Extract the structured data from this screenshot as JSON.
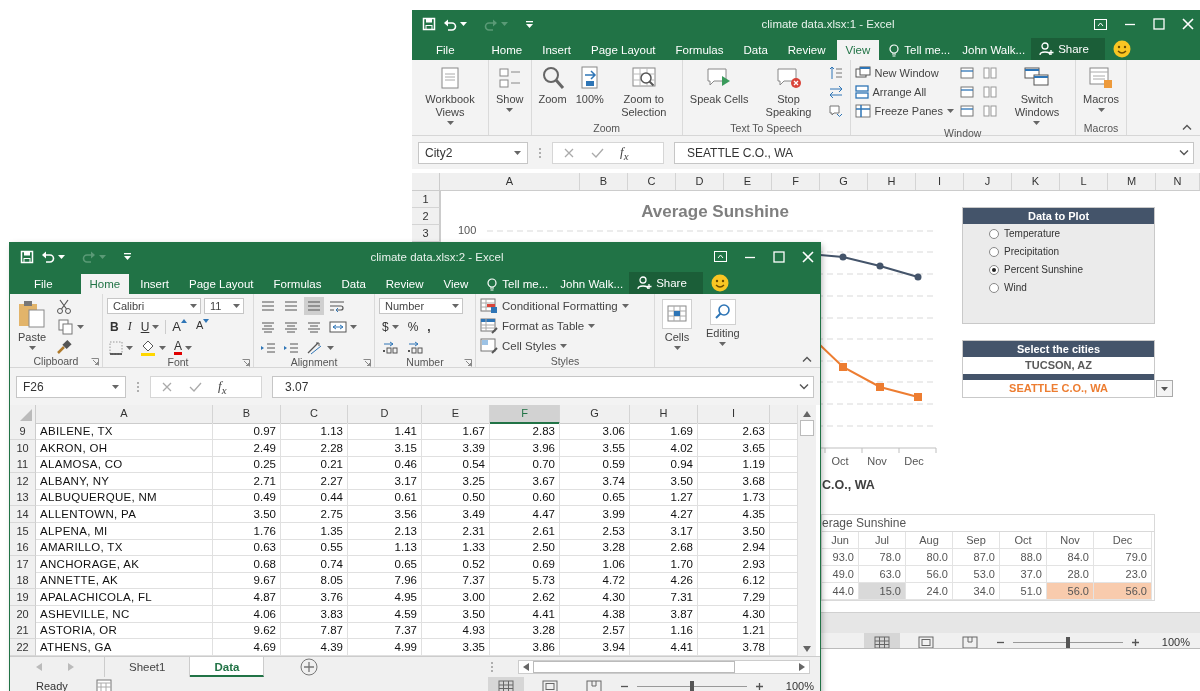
{
  "back_window": {
    "title": "climate data.xlsx:1 - Excel",
    "tabs": [
      {
        "label": "File",
        "selected": false
      },
      {
        "label": "Home",
        "selected": false
      },
      {
        "label": "Insert",
        "selected": false
      },
      {
        "label": "Page Layout",
        "selected": false
      },
      {
        "label": "Formulas",
        "selected": false
      },
      {
        "label": "Data",
        "selected": false
      },
      {
        "label": "Review",
        "selected": false
      },
      {
        "label": "View",
        "selected": true
      }
    ],
    "tell_me": "Tell me...",
    "account": "John Walk...",
    "share": "Share",
    "ribbon_groups": [
      {
        "items": [
          {
            "kind": "large",
            "label": "Workbook Views",
            "menu": true
          }
        ]
      },
      {
        "items": [
          {
            "kind": "large",
            "label": "Show",
            "menu": true
          }
        ]
      },
      {
        "label": "Zoom",
        "items": [
          {
            "kind": "large",
            "label": "Zoom",
            "menu": false
          },
          {
            "kind": "large",
            "label": "100%",
            "menu": false
          },
          {
            "kind": "large",
            "label": "Zoom to Selection",
            "menu": false
          }
        ]
      },
      {
        "label": "Text To Speech",
        "items": [
          {
            "kind": "large",
            "label": "Speak Cells",
            "menu": false
          },
          {
            "kind": "large",
            "label": "Stop Speaking",
            "menu": false
          },
          {
            "kind": "icon"
          },
          {
            "kind": "icon"
          },
          {
            "kind": "icon"
          }
        ]
      },
      {
        "label": "Window",
        "items": [
          {
            "kind": "small",
            "label": "New Window",
            "menu": false
          },
          {
            "kind": "small",
            "label": "Arrange All",
            "menu": false
          },
          {
            "kind": "small",
            "label": "Freeze Panes",
            "menu": true
          },
          {
            "kind": "icon"
          },
          {
            "kind": "icon"
          },
          {
            "kind": "icon"
          },
          {
            "kind": "icon"
          },
          {
            "kind": "icon"
          },
          {
            "kind": "icon"
          },
          {
            "kind": "large",
            "label": "Switch Windows",
            "menu": true
          }
        ]
      },
      {
        "label": "Macros",
        "items": [
          {
            "kind": "large",
            "label": "Macros",
            "menu": true
          }
        ]
      }
    ],
    "name_box": "City2",
    "function_label": "f$_{x}$",
    "formula": "SEATTLE C.O., WA",
    "columns": [
      "A",
      "B",
      "C",
      "D",
      "E",
      "F",
      "G",
      "H",
      "I",
      "J",
      "K",
      "L",
      "M",
      "N"
    ],
    "rows": [
      "1",
      "2",
      "3"
    ],
    "chart": {
      "title": "Average Sunshine",
      "y_tick": "100",
      "x_labels": [
        "Oct",
        "Nov",
        "Dec"
      ],
      "subtitle": "C.O., WA"
    },
    "plot_panel": {
      "title": "Data to Plot",
      "options": [
        {
          "label": "Temperature",
          "selected": false
        },
        {
          "label": "Precipitation",
          "selected": false
        },
        {
          "label": "Percent Sunshine",
          "selected": true
        },
        {
          "label": "Wind",
          "selected": false
        }
      ]
    },
    "cities_panel": {
      "title": "Select the cities",
      "cities": [
        {
          "name": "TUCSON, AZ",
          "color": "#595959"
        },
        {
          "name": "SEATTLE C.O., WA",
          "color": "#ed7d31"
        }
      ]
    },
    "table": {
      "title": "erage Sunshine",
      "columns": [
        "Jun",
        "Jul",
        "Aug",
        "Sep",
        "Oct",
        "Nov",
        "Dec"
      ],
      "rows": [
        [
          {
            "text": "93.0"
          },
          {
            "text": "78.0"
          },
          {
            "text": "80.0"
          },
          {
            "text": "87.0"
          },
          {
            "text": "88.0"
          },
          {
            "text": "84.0"
          },
          {
            "text": "79.0"
          }
        ],
        [
          {
            "text": "49.0"
          },
          {
            "text": "63.0"
          },
          {
            "text": "56.0"
          },
          {
            "text": "53.0"
          },
          {
            "text": "37.0"
          },
          {
            "text": "28.0"
          },
          {
            "text": "23.0"
          }
        ],
        [
          {
            "text": "44.0"
          },
          {
            "text": "15.0",
            "color": "#d9d9d9"
          },
          {
            "text": "24.0"
          },
          {
            "text": "34.0"
          },
          {
            "text": "51.0"
          },
          {
            "text": "56.0",
            "color": "#f8cbad"
          },
          {
            "text": "56.0",
            "color": "#f8cbad"
          }
        ]
      ]
    },
    "status": {
      "views": [
        {
          "selected": true
        },
        {
          "selected": false
        },
        {
          "selected": false
        }
      ],
      "level": 0.5,
      "zoom": "100%"
    }
  },
  "front_window": {
    "title": "climate data.xlsx:2 - Excel",
    "tabs": [
      {
        "label": "File",
        "selected": false
      },
      {
        "label": "Home",
        "selected": true
      },
      {
        "label": "Insert",
        "selected": false
      },
      {
        "label": "Page Layout",
        "selected": false
      },
      {
        "label": "Formulas",
        "selected": false
      },
      {
        "label": "Data",
        "selected": false
      },
      {
        "label": "Review",
        "selected": false
      },
      {
        "label": "View",
        "selected": false
      }
    ],
    "tell_me": "Tell me...",
    "account": "John Walk...",
    "share": "Share",
    "clipboard": {
      "label": "Clipboard",
      "paste": "Paste"
    },
    "font": {
      "label": "Font",
      "name": "Calibri",
      "size": "11",
      "bold": "B",
      "italic": "I",
      "underline": "U",
      "grow": "A",
      "shrink": "A",
      "font_color": "A"
    },
    "alignment": {
      "label": "Alignment",
      "vertical": [
        {
          "selected": false
        },
        {
          "selected": false
        },
        {
          "selected": true
        }
      ]
    },
    "number": {
      "label": "Number",
      "format": "Number",
      "currency": "$",
      "percent": "%",
      "comma": ","
    },
    "styles": {
      "label": "Styles",
      "items": [
        "Conditional Formatting",
        "Format as Table",
        "Cell Styles"
      ]
    },
    "cells": "Cells",
    "editing": "Editing",
    "name_box": "F26",
    "function_label": "f$_{x}$",
    "formula": "3.07",
    "columns": [
      {
        "label": "A",
        "selected": false
      },
      {
        "label": "B",
        "selected": false
      },
      {
        "label": "C",
        "selected": false
      },
      {
        "label": "D",
        "selected": false
      },
      {
        "label": "E",
        "selected": false
      },
      {
        "label": "F",
        "selected": true
      },
      {
        "label": "G",
        "selected": false
      },
      {
        "label": "H",
        "selected": false
      },
      {
        "label": "I",
        "selected": false
      }
    ],
    "rows": [
      {
        "number": "9",
        "cells": [
          "ABILENE, TX",
          "0.97",
          "1.13",
          "1.41",
          "1.67",
          "2.83",
          "3.06",
          "1.69",
          "2.63"
        ]
      },
      {
        "number": "10",
        "cells": [
          "AKRON, OH",
          "2.49",
          "2.28",
          "3.15",
          "3.39",
          "3.96",
          "3.55",
          "4.02",
          "3.65"
        ]
      },
      {
        "number": "11",
        "cells": [
          "ALAMOSA, CO",
          "0.25",
          "0.21",
          "0.46",
          "0.54",
          "0.70",
          "0.59",
          "0.94",
          "1.19"
        ]
      },
      {
        "number": "12",
        "cells": [
          "ALBANY, NY",
          "2.71",
          "2.27",
          "3.17",
          "3.25",
          "3.67",
          "3.74",
          "3.50",
          "3.68"
        ]
      },
      {
        "number": "13",
        "cells": [
          "ALBUQUERQUE, NM",
          "0.49",
          "0.44",
          "0.61",
          "0.50",
          "0.60",
          "0.65",
          "1.27",
          "1.73"
        ]
      },
      {
        "number": "14",
        "cells": [
          "ALLENTOWN, PA",
          "3.50",
          "2.75",
          "3.56",
          "3.49",
          "4.47",
          "3.99",
          "4.27",
          "4.35"
        ]
      },
      {
        "number": "15",
        "cells": [
          "ALPENA, MI",
          "1.76",
          "1.35",
          "2.13",
          "2.31",
          "2.61",
          "2.53",
          "3.17",
          "3.50"
        ]
      },
      {
        "number": "16",
        "cells": [
          "AMARILLO, TX",
          "0.63",
          "0.55",
          "1.13",
          "1.33",
          "2.50",
          "3.28",
          "2.68",
          "2.94"
        ]
      },
      {
        "number": "17",
        "cells": [
          "ANCHORAGE, AK",
          "0.68",
          "0.74",
          "0.65",
          "0.52",
          "0.69",
          "1.06",
          "1.70",
          "2.93"
        ]
      },
      {
        "number": "18",
        "cells": [
          "ANNETTE, AK",
          "9.67",
          "8.05",
          "7.96",
          "7.37",
          "5.73",
          "4.72",
          "4.26",
          "6.12"
        ]
      },
      {
        "number": "19",
        "cells": [
          "APALACHICOLA, FL",
          "4.87",
          "3.76",
          "4.95",
          "3.00",
          "2.62",
          "4.30",
          "7.31",
          "7.29"
        ]
      },
      {
        "number": "20",
        "cells": [
          "ASHEVILLE, NC",
          "4.06",
          "3.83",
          "4.59",
          "3.50",
          "4.41",
          "4.38",
          "3.87",
          "4.30"
        ]
      },
      {
        "number": "21",
        "cells": [
          "ASTORIA, OR",
          "9.62",
          "7.87",
          "7.37",
          "4.93",
          "3.28",
          "2.57",
          "1.16",
          "1.21"
        ]
      },
      {
        "number": "22",
        "cells": [
          "ATHENS, GA",
          "4.69",
          "4.39",
          "4.99",
          "3.35",
          "3.86",
          "3.94",
          "4.41",
          "3.78"
        ]
      }
    ],
    "sheet_tabs": [
      {
        "label": "Sheet1",
        "selected": false
      },
      {
        "label": "Data",
        "selected": true
      }
    ],
    "status": {
      "text": "Ready",
      "views": [
        {
          "selected": true
        },
        {
          "selected": false
        },
        {
          "selected": false
        }
      ],
      "level": 0.5,
      "zoom": "100%"
    }
  }
}
